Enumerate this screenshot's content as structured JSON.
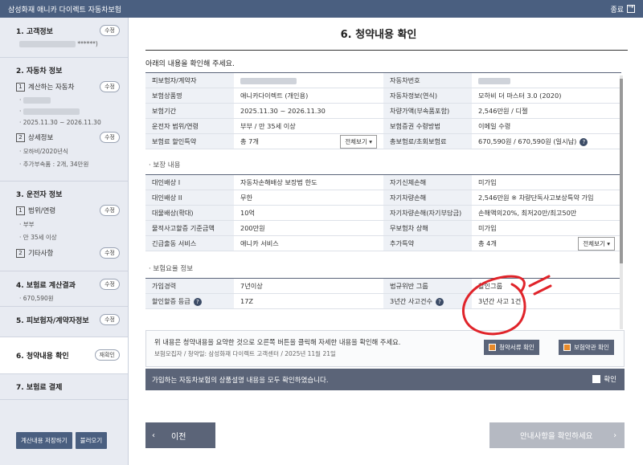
{
  "titlebar": {
    "title": "삼성화재 애니카 다이렉트 자동차보험",
    "close_label": "종료"
  },
  "sidebar": {
    "edit_label": "수정",
    "reenter_label": "재확인",
    "sec1": {
      "title": "1. 고객정보",
      "masked": "******)"
    },
    "sec2": {
      "title": "2. 자동차 정보",
      "sub1": "계산하는 자동차",
      "period": "2025.11.30 ~ 2026.11.30",
      "sub2": "상세정보",
      "year": "모하비/2020년식",
      "extras": "추가부속품 : 2개, 34만원"
    },
    "sec3": {
      "title": "3. 운전자 정보",
      "sub1": "범위/연령",
      "scope": "부부",
      "age": "만 35세 이상",
      "sub2": "기타사항"
    },
    "sec4": {
      "title": "4. 보험료 계산결과",
      "amount": "670,590원"
    },
    "sec5": {
      "title": "5. 피보험자/계약자정보"
    },
    "sec6": {
      "title": "6. 청약내용 확인"
    },
    "sec7": {
      "title": "7. 보험료 결제"
    },
    "save_label": "계산내용 저장하기",
    "load_label": "불러오기",
    "num1": "1",
    "num2": "2"
  },
  "main": {
    "title": "6. 청약내용 확인",
    "intro": "아래의 내용을 확인해 주세요.",
    "basic": {
      "rows": [
        [
          "피보험자/계약자",
          "",
          "자동차번호",
          ""
        ],
        [
          "보험상품명",
          "애니카다이렉트 (개인용)",
          "자동차정보(연식)",
          "모하비 더 마스터 3.0 (2020)"
        ],
        [
          "보험기간",
          "2025.11.30 ~ 2026.11.30",
          "차량가액(부속품포함)",
          "2,546만원 / 디젤"
        ],
        [
          "운전자 범위/연령",
          "부부 / 만 35세 이상",
          "보험증권 수령방법",
          "이메일 수령"
        ],
        [
          "보험료 할인특약",
          "총 7개",
          "총보험료/초회보험료",
          "670,590원 / 670,590원 (일시납)"
        ]
      ],
      "more_label": "전체보기 ▾"
    },
    "coverage": {
      "title": "· 보장 내용",
      "rows": [
        [
          "대인배상 I",
          "자동차손해배상 보장법 한도",
          "자기신체손해",
          "미가입"
        ],
        [
          "대인배상 II",
          "무한",
          "자기차량손해",
          "2,546만원 ※ 차량단독사고보상특약 가입"
        ],
        [
          "대물배상(확대)",
          "10억",
          "자기차량손해(자기부담금)",
          "손해액의20%, 최저20만/최고50만"
        ],
        [
          "물적사고할증 기준금액",
          "200만원",
          "무보험차 상해",
          "미가입"
        ],
        [
          "긴급출동 서비스",
          "애니카 서비스",
          "추가특약",
          "총 4개"
        ]
      ],
      "more_label": "전체보기 ▾"
    },
    "rate": {
      "title": "· 보험요율 정보",
      "rows": [
        [
          "가입경력",
          "7년이상",
          "법규위반 그룹",
          "할인그룹"
        ],
        [
          "할인할증 등급",
          "17Z",
          "3년간 사고건수",
          "3년간 사고 1건"
        ]
      ]
    },
    "notice": {
      "line1": "위 내용은 청약내용을 요약한 것으로 오른쪽 버튼을 클릭해 자세한 내용을 확인해 주세요.",
      "line2": "보험모집자 / 청약일: 삼성화재 다이렉트 고객센터 / 2025년 11월 21일",
      "btn1": "청약서류 확인",
      "btn2": "보험약관 확인"
    },
    "confirm": {
      "text": "가입하는 자동차보험의 상품설명 내용을 모두 확인하였습니다.",
      "check_label": "확인"
    },
    "prev_label": "이전",
    "next_label": "안내사항을 확인하세요"
  },
  "icons": {
    "help": "help-icon",
    "close": "close-icon"
  },
  "colors": {
    "navy": "#4a5f80",
    "orange": "#e88a2a",
    "annotation_red": "#e0242a"
  }
}
